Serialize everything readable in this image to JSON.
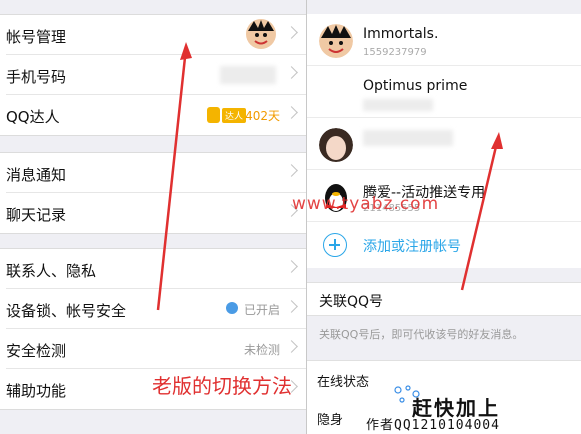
{
  "left": {
    "group1": [
      {
        "label": "帐号管理"
      },
      {
        "label": "手机号码"
      },
      {
        "label": "QQ达人",
        "badge": "达人",
        "days": "402天"
      }
    ],
    "group2": [
      {
        "label": "消息通知"
      },
      {
        "label": "聊天记录"
      }
    ],
    "group3": [
      {
        "label": "联系人、隐私"
      },
      {
        "label": "设备锁、帐号安全",
        "value": "已开启"
      },
      {
        "label": "安全检测",
        "value": "未检测"
      },
      {
        "label": "辅助功能"
      }
    ]
  },
  "right": {
    "accounts": [
      {
        "name": "Immortals.",
        "sub": "1559237979"
      },
      {
        "name": "Optimus prime",
        "sub": ""
      },
      {
        "name": "",
        "sub": ""
      },
      {
        "name": "腾爱--活动推送专用",
        "sub": "211485555"
      }
    ],
    "add_label": "添加或注册帐号",
    "assoc_label": "关联QQ号",
    "assoc_desc": "关联QQ号后，即可代收该号的好友消息。",
    "online_label": "在线状态",
    "stealth_label": "隐身"
  },
  "annotations": {
    "caption": "老版的切换方法",
    "watermark": "www.tyabz.com",
    "brand": "赶快加上",
    "brand_sub": "作者QQ1210104004"
  },
  "colors": {
    "accent": "#2aa6e8",
    "annotation": "#e03030",
    "days": "#f29b00"
  }
}
